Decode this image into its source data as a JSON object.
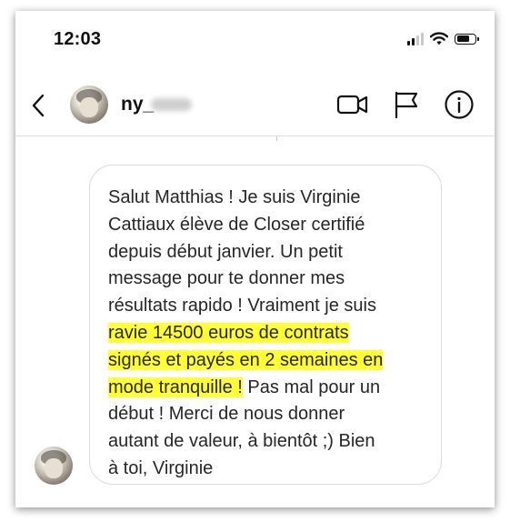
{
  "status_bar": {
    "time": "12:03",
    "icons": [
      "cellular-signal-icon",
      "wifi-icon",
      "battery-icon"
    ]
  },
  "header": {
    "username_visible": "ny_",
    "username_redacted": true,
    "icons": [
      "back-chevron-icon",
      "video-call-icon",
      "flag-icon",
      "info-icon"
    ]
  },
  "message": {
    "before": "Salut Matthias ! Je suis Virginie\nCattiaux élève de Closer certifié\ndepuis début janvier. Un petit\nmessage pour te donner mes\nrésultats rapido ! Vraiment je suis\n",
    "highlight_1": "ravie 14500 euros de contrats",
    "highlight_2": "signés et payés en 2 semaines en",
    "highlight_3": "mode tranquille !",
    "after": " Pas mal pour un\ndébut ! Merci de nous donner\nautant de valeur, à bientôt ;) Bien\nà toi, Virginie",
    "highlight_color": "#ffff33"
  },
  "colors": {
    "text": "#262626",
    "bubble_border": "#dbdbdb",
    "background": "#ffffff"
  }
}
